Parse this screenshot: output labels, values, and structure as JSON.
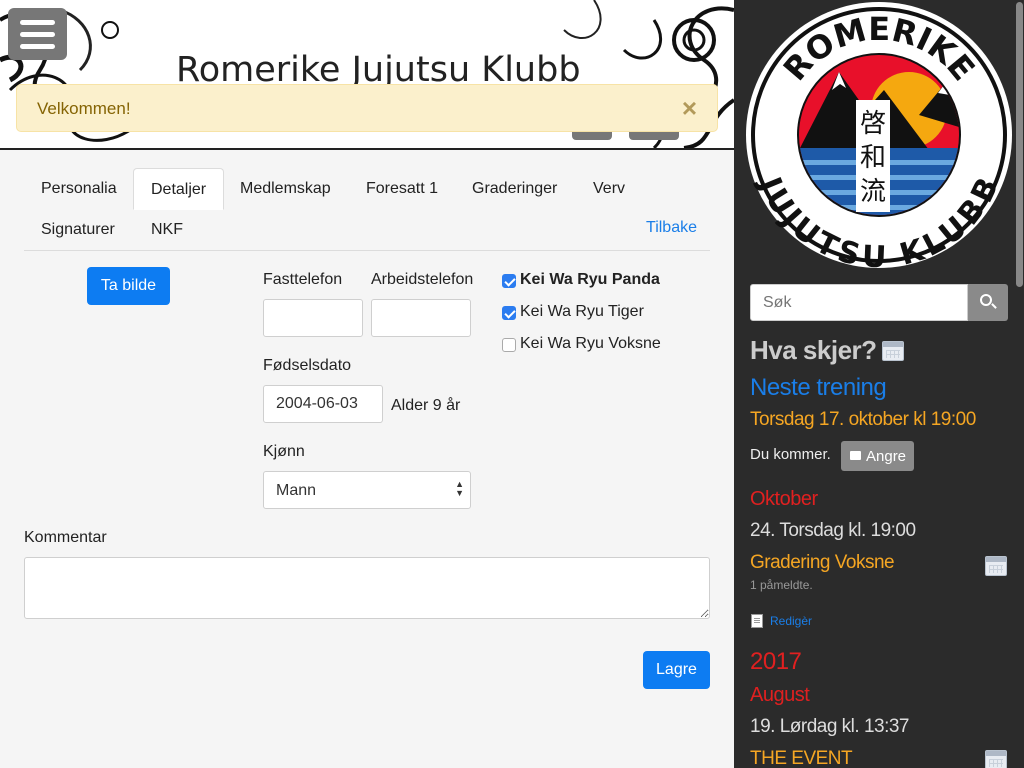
{
  "banner": {
    "title": "Romerike Jujutsu Klubb"
  },
  "alert": {
    "message": "Velkommen!",
    "close_glyph": "×"
  },
  "tabs": [
    {
      "label": "Personalia",
      "active": false
    },
    {
      "label": "Detaljer",
      "active": true
    },
    {
      "label": "Medlemskap",
      "active": false
    },
    {
      "label": "Foresatt 1",
      "active": false
    },
    {
      "label": "Graderinger",
      "active": false
    },
    {
      "label": "Verv",
      "active": false
    },
    {
      "label": "Signaturer",
      "active": false
    },
    {
      "label": "NKF",
      "active": false
    }
  ],
  "back_link": "Tilbake",
  "form": {
    "take_photo": "Ta bilde",
    "landline_label": "Fasttelefon",
    "landline_value": "",
    "work_phone_label": "Arbeidstelefon",
    "work_phone_value": "",
    "birthdate_label": "Fødselsdato",
    "birthdate_value": "2004-06-03",
    "age_text": "Alder 9 år",
    "gender_label": "Kjønn",
    "gender_value": "Mann",
    "comment_label": "Kommentar",
    "comment_value": "",
    "save": "Lagre",
    "checkboxes": [
      {
        "label": "Kei Wa Ryu Panda",
        "checked": true
      },
      {
        "label": "Kei Wa Ryu Tiger",
        "checked": true
      },
      {
        "label": "Kei Wa Ryu Voksne",
        "checked": false
      }
    ]
  },
  "logo": {
    "top_text": "ROMERIKE",
    "bottom_text": "JUJUTSU KLUBB",
    "kanji": [
      "啓",
      "和",
      "流"
    ]
  },
  "sidebar": {
    "search_placeholder": "Søk",
    "whats_on": "Hva skjer?",
    "next_training_heading": "Neste trening",
    "next_training_date": "Torsdag 17. oktober kl 19:00",
    "attending_text": "Du kommer.",
    "undo_button": "Angre",
    "events": {
      "month1": "Oktober",
      "event1_date": "24. Torsdag kl. 19:00",
      "event1_title": "Gradering Voksne",
      "event1_signups": "1 påmeldte.",
      "edit_link": "Redigèr",
      "year": "2017",
      "month2": "August",
      "event2_date": "19. Lørdag kl. 13:37",
      "event2_title": "THE EVENT"
    }
  },
  "colors": {
    "primary": "#0d7cf2",
    "sidebar_bg": "#2b2b2b",
    "accent_orange": "#f5a623",
    "accent_red": "#e02020",
    "accent_blue": "#1a7ee8",
    "alert_bg": "#fbf0cc"
  }
}
